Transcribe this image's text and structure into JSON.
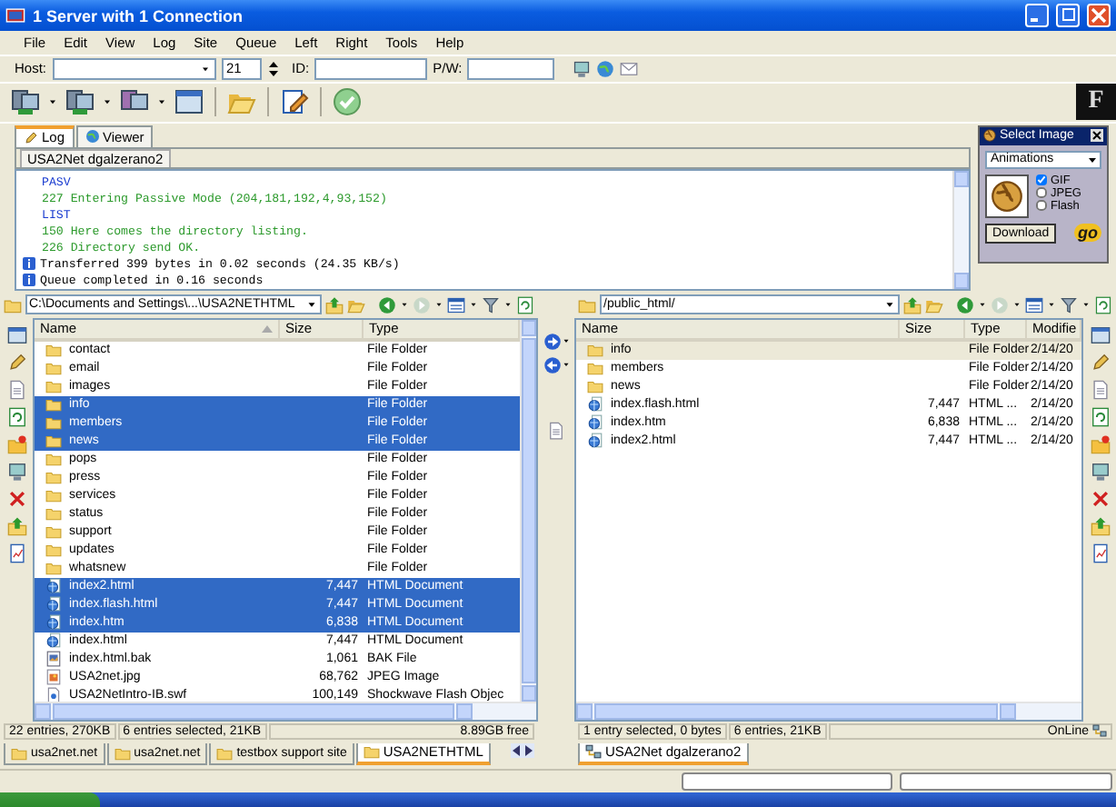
{
  "window": {
    "title": "1 Server with 1 Connection"
  },
  "menu": [
    "File",
    "Edit",
    "View",
    "Log",
    "Site",
    "Queue",
    "Left",
    "Right",
    "Tools",
    "Help"
  ],
  "connection": {
    "host_label": "Host:",
    "port": "21",
    "id_label": "ID:",
    "pw_label": "P/W:"
  },
  "brand_mark": "F",
  "log": {
    "tabs": [
      {
        "label": "Log",
        "selected": true
      },
      {
        "label": "Viewer",
        "selected": false
      }
    ],
    "session_tab": "USA2Net dgalzerano2",
    "lines": [
      {
        "kind": "command",
        "text": "PASV"
      },
      {
        "kind": "reply",
        "text": "227 Entering Passive Mode (204,181,192,4,93,152)"
      },
      {
        "kind": "command",
        "text": "LIST"
      },
      {
        "kind": "reply",
        "text": "150 Here comes the directory listing."
      },
      {
        "kind": "reply",
        "text": "226 Directory send OK."
      },
      {
        "kind": "info",
        "text": "Transferred 399 bytes in 0.02 seconds (24.35 KB/s)"
      },
      {
        "kind": "info",
        "text": "Queue completed in 0.16 seconds"
      }
    ]
  },
  "select_image": {
    "title": "Select Image",
    "dropdown": "Animations",
    "options": [
      {
        "label": "GIF",
        "checked": true
      },
      {
        "label": "JPEG",
        "checked": false
      },
      {
        "label": "Flash",
        "checked": false
      }
    ],
    "button": "Download",
    "logo": "go"
  },
  "left_pane": {
    "kind": "local",
    "path": "C:\\Documents and Settings\\...\\USA2NETHTML",
    "columns": [
      "Name",
      "Size",
      "Type"
    ],
    "rows": [
      {
        "kind": "folder",
        "name": "contact",
        "size": "",
        "type": "File Folder",
        "selected": false
      },
      {
        "kind": "folder",
        "name": "email",
        "size": "",
        "type": "File Folder",
        "selected": false
      },
      {
        "kind": "folder",
        "name": "images",
        "size": "",
        "type": "File Folder",
        "selected": false
      },
      {
        "kind": "folder",
        "name": "info",
        "size": "",
        "type": "File Folder",
        "selected": true
      },
      {
        "kind": "folder",
        "name": "members",
        "size": "",
        "type": "File Folder",
        "selected": true
      },
      {
        "kind": "folder",
        "name": "news",
        "size": "",
        "type": "File Folder",
        "selected": true
      },
      {
        "kind": "folder",
        "name": "pops",
        "size": "",
        "type": "File Folder",
        "selected": false
      },
      {
        "kind": "folder",
        "name": "press",
        "size": "",
        "type": "File Folder",
        "selected": false
      },
      {
        "kind": "folder",
        "name": "services",
        "size": "",
        "type": "File Folder",
        "selected": false
      },
      {
        "kind": "folder",
        "name": "status",
        "size": "",
        "type": "File Folder",
        "selected": false
      },
      {
        "kind": "folder",
        "name": "support",
        "size": "",
        "type": "File Folder",
        "selected": false
      },
      {
        "kind": "folder",
        "name": "updates",
        "size": "",
        "type": "File Folder",
        "selected": false
      },
      {
        "kind": "folder",
        "name": "whatsnew",
        "size": "",
        "type": "File Folder",
        "selected": false
      },
      {
        "kind": "html",
        "name": "index2.html",
        "size": "7,447",
        "type": "HTML Document",
        "selected": true
      },
      {
        "kind": "html",
        "name": "index.flash.html",
        "size": "7,447",
        "type": "HTML Document",
        "selected": true
      },
      {
        "kind": "html",
        "name": "index.htm",
        "size": "6,838",
        "type": "HTML Document",
        "selected": true
      },
      {
        "kind": "html",
        "name": "index.html",
        "size": "7,447",
        "type": "HTML Document",
        "selected": false
      },
      {
        "kind": "bak",
        "name": "index.html.bak",
        "size": "1,061",
        "type": "BAK File",
        "selected": false
      },
      {
        "kind": "image",
        "name": "USA2net.jpg",
        "size": "68,762",
        "type": "JPEG Image",
        "selected": false
      },
      {
        "kind": "flash",
        "name": "USA2NetIntro-IB.swf",
        "size": "100,149",
        "type": "Shockwave Flash Objec",
        "selected": false
      }
    ],
    "status": [
      {
        "kind": "count",
        "text": "22 entries, 270KB"
      },
      {
        "kind": "count",
        "text": "6 entries selected, 21KB"
      },
      {
        "kind": "free",
        "text": "8.89GB free"
      }
    ],
    "tabs": [
      {
        "label": "usa2net.net",
        "selected": false
      },
      {
        "label": "usa2net.net",
        "selected": false
      },
      {
        "label": "testbox support site",
        "selected": false
      },
      {
        "label": "USA2NETHTML",
        "selected": true
      }
    ]
  },
  "right_pane": {
    "kind": "remote",
    "path": "/public_html/",
    "columns": [
      "Name",
      "Size",
      "Type",
      "Modifie"
    ],
    "rows": [
      {
        "kind": "folder",
        "name": "info",
        "size": "",
        "type": "File Folder",
        "modified": "2/14/20",
        "selected": false,
        "focused": true
      },
      {
        "kind": "folder",
        "name": "members",
        "size": "",
        "type": "File Folder",
        "modified": "2/14/20",
        "selected": false,
        "focused": false
      },
      {
        "kind": "folder",
        "name": "news",
        "size": "",
        "type": "File Folder",
        "modified": "2/14/20",
        "selected": false,
        "focused": false
      },
      {
        "kind": "html",
        "name": "index.flash.html",
        "size": "7,447",
        "type": "HTML ...",
        "modified": "2/14/20",
        "selected": false,
        "focused": false
      },
      {
        "kind": "html",
        "name": "index.htm",
        "size": "6,838",
        "type": "HTML ...",
        "modified": "2/14/20",
        "selected": false,
        "focused": false
      },
      {
        "kind": "html",
        "name": "index2.html",
        "size": "7,447",
        "type": "HTML ...",
        "modified": "2/14/20",
        "selected": false,
        "focused": false
      }
    ],
    "status": [
      {
        "kind": "count",
        "text": "1 entry selected, 0 bytes"
      },
      {
        "kind": "count",
        "text": "6 entries, 21KB"
      },
      {
        "kind": "connection",
        "text": "OnLine"
      }
    ],
    "tabs": [
      {
        "label": "USA2Net dgalzerano2",
        "selected": true
      }
    ]
  }
}
